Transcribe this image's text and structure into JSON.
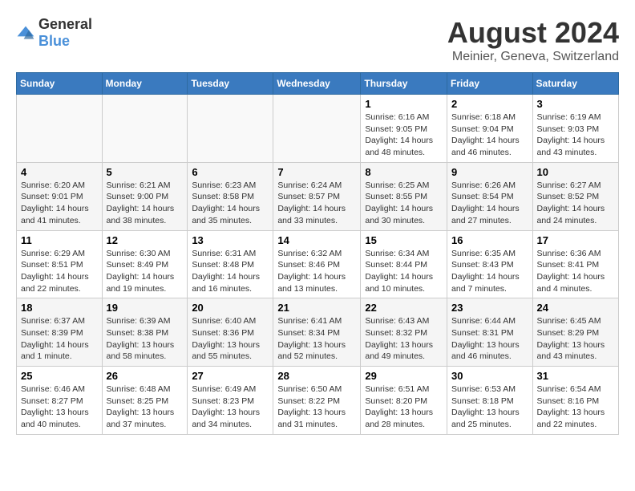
{
  "logo": {
    "text_general": "General",
    "text_blue": "Blue"
  },
  "calendar": {
    "title": "August 2024",
    "subtitle": "Meinier, Geneva, Switzerland"
  },
  "days_of_week": [
    "Sunday",
    "Monday",
    "Tuesday",
    "Wednesday",
    "Thursday",
    "Friday",
    "Saturday"
  ],
  "weeks": [
    [
      {
        "day": "",
        "info": ""
      },
      {
        "day": "",
        "info": ""
      },
      {
        "day": "",
        "info": ""
      },
      {
        "day": "",
        "info": ""
      },
      {
        "day": "1",
        "info": "Sunrise: 6:16 AM\nSunset: 9:05 PM\nDaylight: 14 hours and 48 minutes."
      },
      {
        "day": "2",
        "info": "Sunrise: 6:18 AM\nSunset: 9:04 PM\nDaylight: 14 hours and 46 minutes."
      },
      {
        "day": "3",
        "info": "Sunrise: 6:19 AM\nSunset: 9:03 PM\nDaylight: 14 hours and 43 minutes."
      }
    ],
    [
      {
        "day": "4",
        "info": "Sunrise: 6:20 AM\nSunset: 9:01 PM\nDaylight: 14 hours and 41 minutes."
      },
      {
        "day": "5",
        "info": "Sunrise: 6:21 AM\nSunset: 9:00 PM\nDaylight: 14 hours and 38 minutes."
      },
      {
        "day": "6",
        "info": "Sunrise: 6:23 AM\nSunset: 8:58 PM\nDaylight: 14 hours and 35 minutes."
      },
      {
        "day": "7",
        "info": "Sunrise: 6:24 AM\nSunset: 8:57 PM\nDaylight: 14 hours and 33 minutes."
      },
      {
        "day": "8",
        "info": "Sunrise: 6:25 AM\nSunset: 8:55 PM\nDaylight: 14 hours and 30 minutes."
      },
      {
        "day": "9",
        "info": "Sunrise: 6:26 AM\nSunset: 8:54 PM\nDaylight: 14 hours and 27 minutes."
      },
      {
        "day": "10",
        "info": "Sunrise: 6:27 AM\nSunset: 8:52 PM\nDaylight: 14 hours and 24 minutes."
      }
    ],
    [
      {
        "day": "11",
        "info": "Sunrise: 6:29 AM\nSunset: 8:51 PM\nDaylight: 14 hours and 22 minutes."
      },
      {
        "day": "12",
        "info": "Sunrise: 6:30 AM\nSunset: 8:49 PM\nDaylight: 14 hours and 19 minutes."
      },
      {
        "day": "13",
        "info": "Sunrise: 6:31 AM\nSunset: 8:48 PM\nDaylight: 14 hours and 16 minutes."
      },
      {
        "day": "14",
        "info": "Sunrise: 6:32 AM\nSunset: 8:46 PM\nDaylight: 14 hours and 13 minutes."
      },
      {
        "day": "15",
        "info": "Sunrise: 6:34 AM\nSunset: 8:44 PM\nDaylight: 14 hours and 10 minutes."
      },
      {
        "day": "16",
        "info": "Sunrise: 6:35 AM\nSunset: 8:43 PM\nDaylight: 14 hours and 7 minutes."
      },
      {
        "day": "17",
        "info": "Sunrise: 6:36 AM\nSunset: 8:41 PM\nDaylight: 14 hours and 4 minutes."
      }
    ],
    [
      {
        "day": "18",
        "info": "Sunrise: 6:37 AM\nSunset: 8:39 PM\nDaylight: 14 hours and 1 minute."
      },
      {
        "day": "19",
        "info": "Sunrise: 6:39 AM\nSunset: 8:38 PM\nDaylight: 13 hours and 58 minutes."
      },
      {
        "day": "20",
        "info": "Sunrise: 6:40 AM\nSunset: 8:36 PM\nDaylight: 13 hours and 55 minutes."
      },
      {
        "day": "21",
        "info": "Sunrise: 6:41 AM\nSunset: 8:34 PM\nDaylight: 13 hours and 52 minutes."
      },
      {
        "day": "22",
        "info": "Sunrise: 6:43 AM\nSunset: 8:32 PM\nDaylight: 13 hours and 49 minutes."
      },
      {
        "day": "23",
        "info": "Sunrise: 6:44 AM\nSunset: 8:31 PM\nDaylight: 13 hours and 46 minutes."
      },
      {
        "day": "24",
        "info": "Sunrise: 6:45 AM\nSunset: 8:29 PM\nDaylight: 13 hours and 43 minutes."
      }
    ],
    [
      {
        "day": "25",
        "info": "Sunrise: 6:46 AM\nSunset: 8:27 PM\nDaylight: 13 hours and 40 minutes."
      },
      {
        "day": "26",
        "info": "Sunrise: 6:48 AM\nSunset: 8:25 PM\nDaylight: 13 hours and 37 minutes."
      },
      {
        "day": "27",
        "info": "Sunrise: 6:49 AM\nSunset: 8:23 PM\nDaylight: 13 hours and 34 minutes."
      },
      {
        "day": "28",
        "info": "Sunrise: 6:50 AM\nSunset: 8:22 PM\nDaylight: 13 hours and 31 minutes."
      },
      {
        "day": "29",
        "info": "Sunrise: 6:51 AM\nSunset: 8:20 PM\nDaylight: 13 hours and 28 minutes."
      },
      {
        "day": "30",
        "info": "Sunrise: 6:53 AM\nSunset: 8:18 PM\nDaylight: 13 hours and 25 minutes."
      },
      {
        "day": "31",
        "info": "Sunrise: 6:54 AM\nSunset: 8:16 PM\nDaylight: 13 hours and 22 minutes."
      }
    ]
  ]
}
